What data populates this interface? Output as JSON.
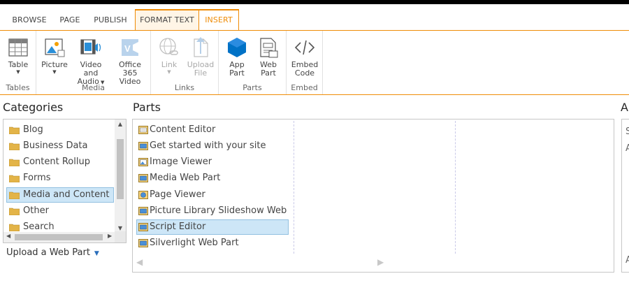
{
  "tabs": [
    "BROWSE",
    "PAGE",
    "PUBLISH",
    "FORMAT TEXT",
    "INSERT"
  ],
  "ribbon": {
    "groups": {
      "tables": "Tables",
      "media": "Media",
      "links": "Links",
      "parts": "Parts",
      "embed": "Embed"
    },
    "buttons": {
      "table": [
        "Table"
      ],
      "picture": [
        "Picture"
      ],
      "video_audio": [
        "Video and",
        "Audio"
      ],
      "office365": [
        "Office 365",
        "Video"
      ],
      "link": [
        "Link"
      ],
      "upload_file": [
        "Upload",
        "File"
      ],
      "app_part": [
        "App",
        "Part"
      ],
      "web_part": [
        "Web",
        "Part"
      ],
      "embed_code": [
        "Embed",
        "Code"
      ]
    }
  },
  "categories": {
    "heading": "Categories",
    "items": [
      "Blog",
      "Business Data",
      "Content Rollup",
      "Forms",
      "Media and Content",
      "Other",
      "Search"
    ],
    "selected": "Media and Content",
    "upload": "Upload a Web Part"
  },
  "parts": {
    "heading": "Parts",
    "items": [
      "Content Editor",
      "Get started with your site",
      "Image Viewer",
      "Media Web Part",
      "Page Viewer",
      "Picture Library Slideshow Web Par",
      "Script Editor",
      "Silverlight Web Part"
    ],
    "selected": "Script Editor"
  },
  "about": {
    "heading": "A",
    "frag1": "S",
    "frag2": "A",
    "frag3": "A"
  },
  "colors": {
    "accent": "#ef8c07",
    "selection": "#cde6f7",
    "app_blue": "#0072c6"
  }
}
